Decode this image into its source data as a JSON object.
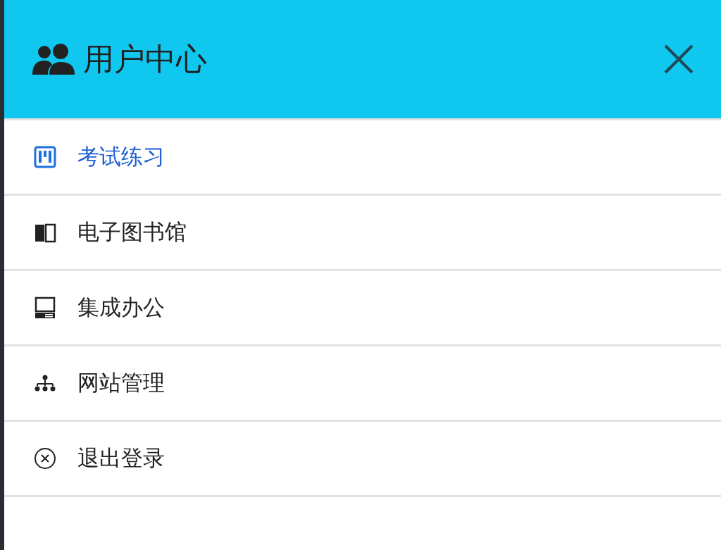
{
  "header": {
    "title": "用户中心"
  },
  "menu": [
    {
      "label": "考试练习",
      "selected": true
    },
    {
      "label": "电子图书馆",
      "selected": false
    },
    {
      "label": "集成办公",
      "selected": false
    },
    {
      "label": "网站管理",
      "selected": false
    },
    {
      "label": "退出登录",
      "selected": false
    }
  ]
}
